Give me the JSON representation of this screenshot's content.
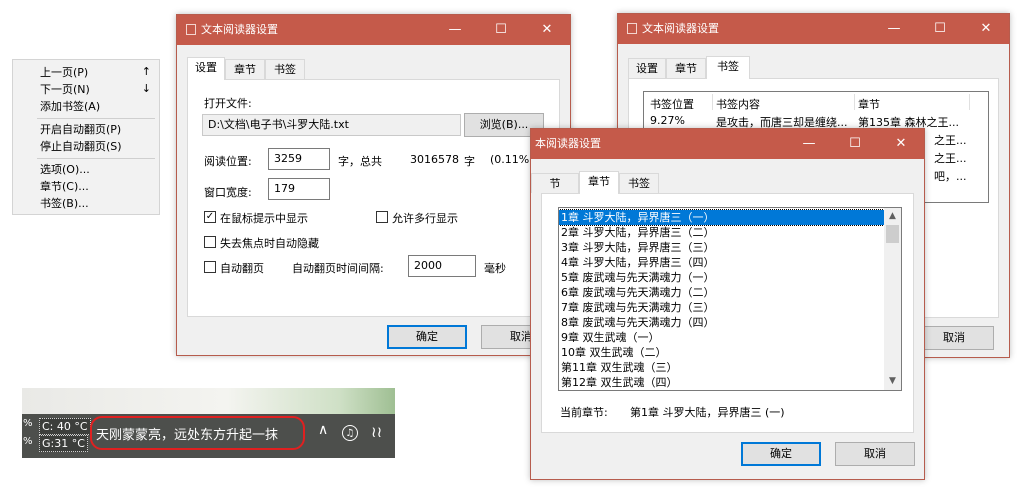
{
  "context_menu": {
    "items": [
      {
        "label": "上一页(P)",
        "shortcut": "↑"
      },
      {
        "label": "下一页(N)",
        "shortcut": "↓"
      },
      {
        "label": "添加书签(A)",
        "shortcut": ""
      },
      {
        "label": "开启自动翻页(P)",
        "shortcut": ""
      },
      {
        "label": "停止自动翻页(S)",
        "shortcut": ""
      },
      {
        "label": "选项(O)...",
        "shortcut": ""
      },
      {
        "label": "章节(C)...",
        "shortcut": ""
      },
      {
        "label": "书签(B)...",
        "shortcut": ""
      }
    ]
  },
  "settings_window": {
    "title": "文本阅读器设置",
    "tabs": [
      "设置",
      "章节",
      "书签"
    ],
    "open_file_label": "打开文件:",
    "file_path": "D:\\文档\\电子书\\斗罗大陆.txt",
    "browse_label": "浏览(B)...",
    "read_position_label": "阅读位置:",
    "read_position_value": "3259",
    "total_prefix": "字，总共",
    "total_value": "3016578",
    "total_suffix": "字",
    "percent": "(0.11%)",
    "window_width_label": "窗口宽度:",
    "window_width_value": "179",
    "show_in_tooltip_label": "在鼠标提示中显示",
    "multiline_label": "允许多行显示",
    "hide_on_blur_label": "失去焦点时自动隐藏",
    "auto_page_label": "自动翻页",
    "interval_label": "自动翻页时间间隔:",
    "interval_value": "2000",
    "interval_unit": "毫秒",
    "ok_label": "确定",
    "cancel_label": "取消"
  },
  "bookmark_window": {
    "title": "文本阅读器设置",
    "tabs": [
      "设置",
      "章节",
      "书签"
    ],
    "columns": [
      "书签位置",
      "书签内容",
      "章节"
    ],
    "rows": [
      {
        "pos": "9.27%",
        "content": "是攻击，而唐三却是缠绕...",
        "chapter": "第135章 森林之王..."
      },
      {
        "pos": "",
        "content": "",
        "chapter": "之王..."
      },
      {
        "pos": "",
        "content": "",
        "chapter": "之王..."
      },
      {
        "pos": "",
        "content": "",
        "chapter": "吧，..."
      }
    ],
    "cancel_label": "取消"
  },
  "chapter_window": {
    "title": "本阅读器设置",
    "tabs": [
      "节",
      "章节",
      "书签"
    ],
    "chapters": [
      "1章 斗罗大陆，异界唐三（一）",
      "2章 斗罗大陆，异界唐三（二）",
      "3章 斗罗大陆，异界唐三（三）",
      "4章 斗罗大陆，异界唐三（四）",
      "5章 废武魂与先天满魂力（一）",
      "6章 废武魂与先天满魂力（二）",
      "7章 废武魂与先天满魂力（三）",
      "8章 废武魂与先天满魂力（四）",
      "9章 双生武魂（一）",
      "10章 双生武魂（二）",
      "第11章 双生武魂（三）",
      "第12章 双生武魂（四）"
    ],
    "selected_index": 0,
    "current_label": "当前章节:",
    "current_value": "第1章 斗罗大陆，异界唐三 (一)",
    "ok_label": "确定",
    "cancel_label": "取消"
  },
  "taskbar": {
    "cpu_temp": "C: 40 °C",
    "gpu_temp": "G:31 °C",
    "pct1": "%",
    "pct2": "%",
    "reader_text": "天刚蒙蒙亮，远处东方升起一抹",
    "highlight_color": "#e02020"
  },
  "colors": {
    "titlebar": "#c55a4a",
    "selection": "#0078d7"
  }
}
